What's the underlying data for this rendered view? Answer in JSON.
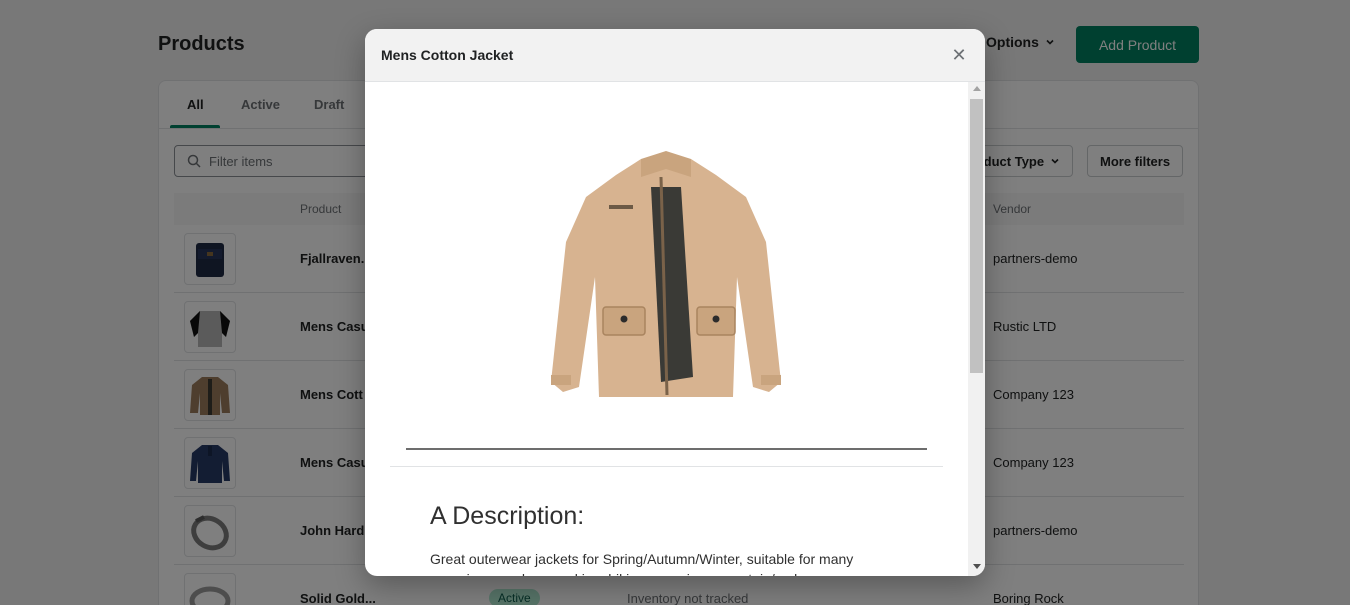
{
  "page": {
    "title": "Products",
    "options_label": "Options",
    "add_button": "Add Product",
    "tabs": [
      "All",
      "Active",
      "Draft"
    ],
    "filter_placeholder": "Filter items",
    "product_type_label": "Product Type",
    "more_filters_label": "More filters",
    "columns": {
      "product": "Product",
      "vendor": "Vendor"
    },
    "rows": [
      {
        "name": "Fjallraven...",
        "vendor": "partners-demo"
      },
      {
        "name": "Mens Casu",
        "vendor": "Rustic LTD"
      },
      {
        "name": "Mens Cott",
        "vendor": "Company 123"
      },
      {
        "name": "Mens Casu",
        "vendor": "Company 123"
      },
      {
        "name": "John Hard",
        "vendor": "partners-demo"
      },
      {
        "name": "Solid Gold...",
        "status": "Active",
        "inventory": "Inventory not tracked",
        "vendor": "Boring Rock"
      }
    ]
  },
  "modal": {
    "title": "Mens Cotton Jacket",
    "close_icon": "close-icon",
    "description_heading": "A Description:",
    "description_text": "Great outerwear jackets for Spring/Autumn/Winter, suitable for many occasions, such as working, hiking, camping, mountain/rock"
  },
  "colors": {
    "primary": "#008060",
    "active_badge": "#aee9d1"
  }
}
